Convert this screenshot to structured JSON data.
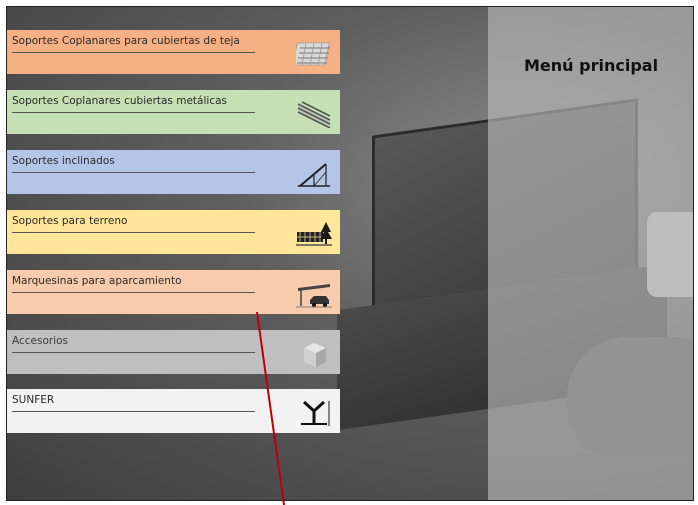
{
  "title": "Menú principal",
  "menu": [
    {
      "label": "Soportes Coplanares para cubiertas de teja",
      "color": "#f5b084",
      "icon": "roof-tile-icon"
    },
    {
      "label": "Soportes Coplanares cubiertas metálicas",
      "color": "#c5e0b3",
      "icon": "metal-roof-icon"
    },
    {
      "label": "Soportes inclinados",
      "color": "#b4c6e7",
      "icon": "inclined-support-icon"
    },
    {
      "label": "Soportes para terreno",
      "color": "#ffe699",
      "icon": "ground-support-icon"
    },
    {
      "label": "Marquesinas para aparcamiento",
      "color": "#f8cbad",
      "icon": "carport-icon"
    },
    {
      "label": "Accesorios",
      "color": "#bfbfbf",
      "icon": "accessories-box-icon"
    },
    {
      "label": "SUNFER",
      "color": "#f2f2f2",
      "icon": "sunfer-logo-icon"
    }
  ],
  "pointer_color": "#c00000"
}
